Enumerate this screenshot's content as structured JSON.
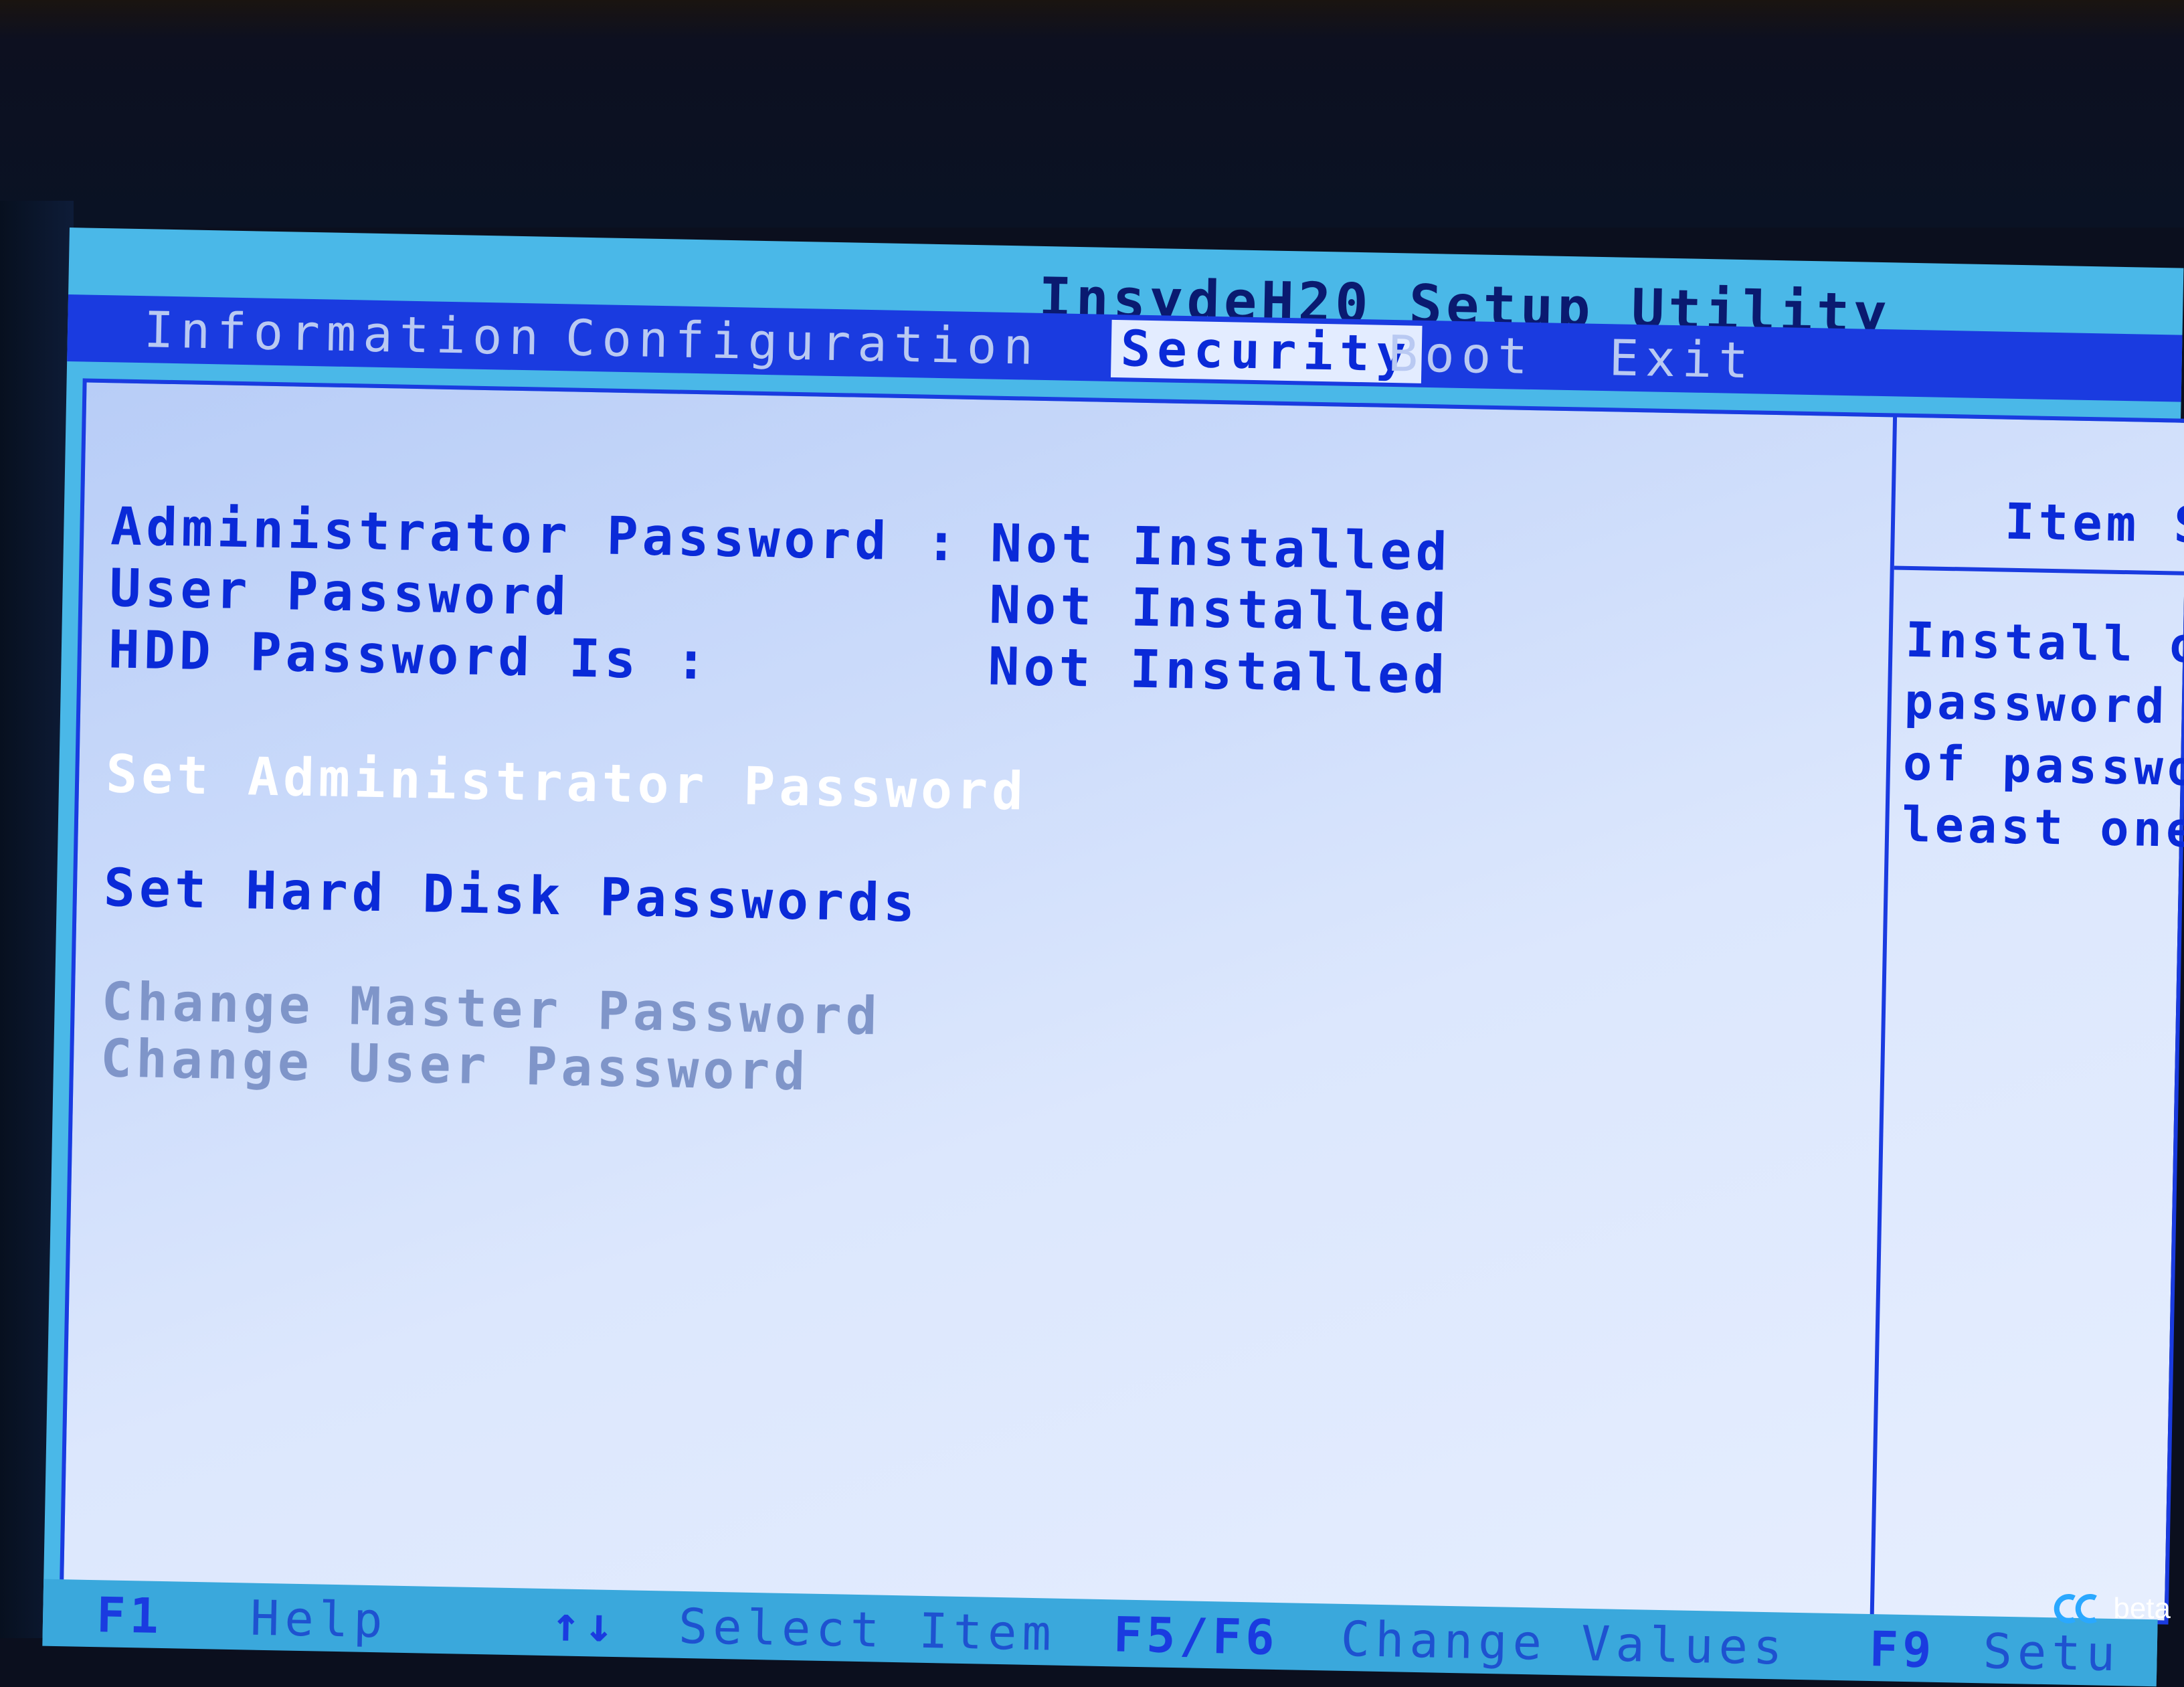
{
  "title": "InsydeH20 Setup Utility",
  "menu": [
    {
      "label": "Information",
      "active": false
    },
    {
      "label": "Configuration",
      "active": false
    },
    {
      "label": "Security",
      "active": true
    },
    {
      "label": "Boot",
      "active": false
    },
    {
      "label": "Exit",
      "active": false
    }
  ],
  "status_rows": [
    {
      "label": "Administrator Password :",
      "value": "Not Installed"
    },
    {
      "label": "User Password",
      "value": "Not Installed"
    },
    {
      "label": "HDD Password Is :",
      "value": "Not Installed"
    }
  ],
  "actions": {
    "set_admin": "Set Administrator Password",
    "set_hdd": "Set Hard Disk Passwords",
    "change_master": "Change Master Password",
    "change_user": "Change User Password"
  },
  "help_panel": {
    "title": "Item S",
    "lines": [
      "Install o",
      "password",
      "of passwo",
      "least one"
    ]
  },
  "status_bar": [
    {
      "key": "F1",
      "desc": "Help"
    },
    {
      "key": "↑↓",
      "desc": "Select Item"
    },
    {
      "key": "F5/F6",
      "desc": "Change Values"
    },
    {
      "key": "F9",
      "desc": "Setu"
    }
  ],
  "watermark": {
    "text": "beta",
    "icon": "cc-logo-icon"
  },
  "colors": {
    "menubar": "#1a3be0",
    "panel": "#dce7fd",
    "statusbar": "#3aa8dc",
    "text": "#0a2ad8",
    "highlight": "#ffffff",
    "disabled": "#7f95c9"
  }
}
